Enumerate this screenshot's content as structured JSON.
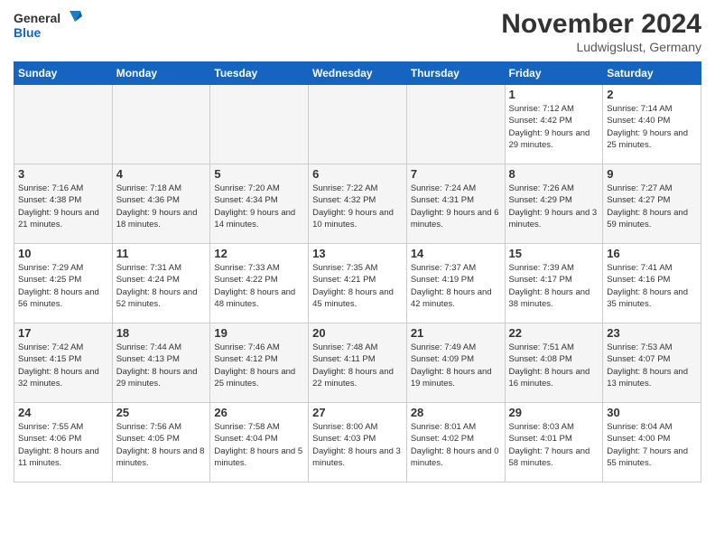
{
  "header": {
    "logo_general": "General",
    "logo_blue": "Blue",
    "month_title": "November 2024",
    "location": "Ludwigslust, Germany"
  },
  "days_of_week": [
    "Sunday",
    "Monday",
    "Tuesday",
    "Wednesday",
    "Thursday",
    "Friday",
    "Saturday"
  ],
  "weeks": [
    [
      {
        "day": "",
        "info": ""
      },
      {
        "day": "",
        "info": ""
      },
      {
        "day": "",
        "info": ""
      },
      {
        "day": "",
        "info": ""
      },
      {
        "day": "",
        "info": ""
      },
      {
        "day": "1",
        "info": "Sunrise: 7:12 AM\nSunset: 4:42 PM\nDaylight: 9 hours and 29 minutes."
      },
      {
        "day": "2",
        "info": "Sunrise: 7:14 AM\nSunset: 4:40 PM\nDaylight: 9 hours and 25 minutes."
      }
    ],
    [
      {
        "day": "3",
        "info": "Sunrise: 7:16 AM\nSunset: 4:38 PM\nDaylight: 9 hours and 21 minutes."
      },
      {
        "day": "4",
        "info": "Sunrise: 7:18 AM\nSunset: 4:36 PM\nDaylight: 9 hours and 18 minutes."
      },
      {
        "day": "5",
        "info": "Sunrise: 7:20 AM\nSunset: 4:34 PM\nDaylight: 9 hours and 14 minutes."
      },
      {
        "day": "6",
        "info": "Sunrise: 7:22 AM\nSunset: 4:32 PM\nDaylight: 9 hours and 10 minutes."
      },
      {
        "day": "7",
        "info": "Sunrise: 7:24 AM\nSunset: 4:31 PM\nDaylight: 9 hours and 6 minutes."
      },
      {
        "day": "8",
        "info": "Sunrise: 7:26 AM\nSunset: 4:29 PM\nDaylight: 9 hours and 3 minutes."
      },
      {
        "day": "9",
        "info": "Sunrise: 7:27 AM\nSunset: 4:27 PM\nDaylight: 8 hours and 59 minutes."
      }
    ],
    [
      {
        "day": "10",
        "info": "Sunrise: 7:29 AM\nSunset: 4:25 PM\nDaylight: 8 hours and 56 minutes."
      },
      {
        "day": "11",
        "info": "Sunrise: 7:31 AM\nSunset: 4:24 PM\nDaylight: 8 hours and 52 minutes."
      },
      {
        "day": "12",
        "info": "Sunrise: 7:33 AM\nSunset: 4:22 PM\nDaylight: 8 hours and 48 minutes."
      },
      {
        "day": "13",
        "info": "Sunrise: 7:35 AM\nSunset: 4:21 PM\nDaylight: 8 hours and 45 minutes."
      },
      {
        "day": "14",
        "info": "Sunrise: 7:37 AM\nSunset: 4:19 PM\nDaylight: 8 hours and 42 minutes."
      },
      {
        "day": "15",
        "info": "Sunrise: 7:39 AM\nSunset: 4:17 PM\nDaylight: 8 hours and 38 minutes."
      },
      {
        "day": "16",
        "info": "Sunrise: 7:41 AM\nSunset: 4:16 PM\nDaylight: 8 hours and 35 minutes."
      }
    ],
    [
      {
        "day": "17",
        "info": "Sunrise: 7:42 AM\nSunset: 4:15 PM\nDaylight: 8 hours and 32 minutes."
      },
      {
        "day": "18",
        "info": "Sunrise: 7:44 AM\nSunset: 4:13 PM\nDaylight: 8 hours and 29 minutes."
      },
      {
        "day": "19",
        "info": "Sunrise: 7:46 AM\nSunset: 4:12 PM\nDaylight: 8 hours and 25 minutes."
      },
      {
        "day": "20",
        "info": "Sunrise: 7:48 AM\nSunset: 4:11 PM\nDaylight: 8 hours and 22 minutes."
      },
      {
        "day": "21",
        "info": "Sunrise: 7:49 AM\nSunset: 4:09 PM\nDaylight: 8 hours and 19 minutes."
      },
      {
        "day": "22",
        "info": "Sunrise: 7:51 AM\nSunset: 4:08 PM\nDaylight: 8 hours and 16 minutes."
      },
      {
        "day": "23",
        "info": "Sunrise: 7:53 AM\nSunset: 4:07 PM\nDaylight: 8 hours and 13 minutes."
      }
    ],
    [
      {
        "day": "24",
        "info": "Sunrise: 7:55 AM\nSunset: 4:06 PM\nDaylight: 8 hours and 11 minutes."
      },
      {
        "day": "25",
        "info": "Sunrise: 7:56 AM\nSunset: 4:05 PM\nDaylight: 8 hours and 8 minutes."
      },
      {
        "day": "26",
        "info": "Sunrise: 7:58 AM\nSunset: 4:04 PM\nDaylight: 8 hours and 5 minutes."
      },
      {
        "day": "27",
        "info": "Sunrise: 8:00 AM\nSunset: 4:03 PM\nDaylight: 8 hours and 3 minutes."
      },
      {
        "day": "28",
        "info": "Sunrise: 8:01 AM\nSunset: 4:02 PM\nDaylight: 8 hours and 0 minutes."
      },
      {
        "day": "29",
        "info": "Sunrise: 8:03 AM\nSunset: 4:01 PM\nDaylight: 7 hours and 58 minutes."
      },
      {
        "day": "30",
        "info": "Sunrise: 8:04 AM\nSunset: 4:00 PM\nDaylight: 7 hours and 55 minutes."
      }
    ]
  ]
}
